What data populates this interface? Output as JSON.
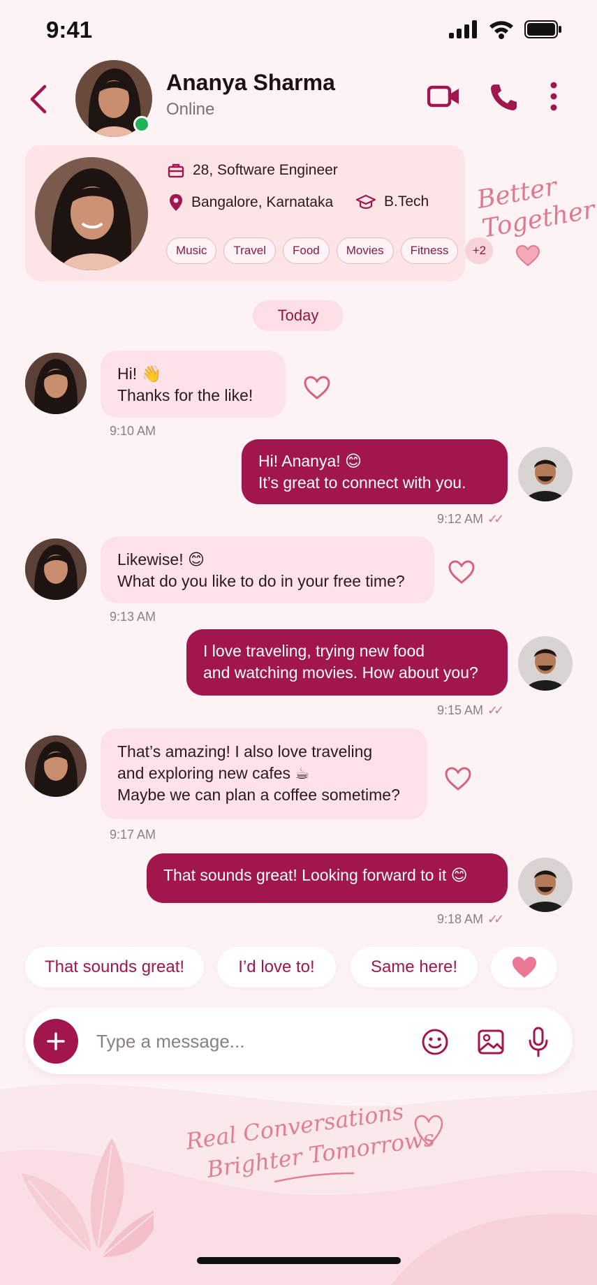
{
  "status_bar": {
    "time": "9:41",
    "icons": [
      "signal-icon",
      "wifi-icon",
      "battery-icon"
    ]
  },
  "header": {
    "name": "Ananya Sharma",
    "status": "Online",
    "icons": [
      "back-icon",
      "video-call-icon",
      "phone-icon",
      "more-icon"
    ]
  },
  "profile": {
    "age_job": "28, Software Engineer",
    "location": "Bangalore, Karnataka",
    "education": "B.Tech",
    "interests": [
      "Music",
      "Travel",
      "Food",
      "Movies",
      "Fitness"
    ],
    "more_count": "+2"
  },
  "decor": {
    "line1": "Better",
    "line2": "Together"
  },
  "day_label": "Today",
  "messages": [
    {
      "from": "her",
      "line1": "Hi! 👋",
      "line2": "Thanks for the like!",
      "time": "9:10 AM"
    },
    {
      "from": "me",
      "line1": "Hi! Ananya! 😊",
      "line2": "It’s great to connect with you.",
      "time": "9:12 AM"
    },
    {
      "from": "her",
      "line1": "Likewise! 😊",
      "line2": "What do you like to do in your free time?",
      "time": "9:13 AM"
    },
    {
      "from": "me",
      "line1": "I love traveling, trying new food",
      "line2": "and watching movies. How about you?",
      "time": "9:15 AM"
    },
    {
      "from": "her",
      "line1": "That’s amazing! I also love traveling",
      "line2": "and exploring new cafes ☕",
      "line3": "Maybe we can plan a coffee sometime?",
      "time": "9:17 AM"
    },
    {
      "from": "me",
      "line1": "That sounds great! Looking forward to it 😊",
      "time": "9:18 AM"
    }
  ],
  "quick_replies": [
    "That sounds great!",
    "I’d love to!",
    "Same here!"
  ],
  "composer": {
    "placeholder": "Type a message..."
  },
  "footer": {
    "line1": "Real Conversations",
    "line2": "Brighter Tomorrows"
  },
  "colors": {
    "accent": "#a0164d",
    "bubble_in": "#fde3e7",
    "online": "#22b35a"
  }
}
